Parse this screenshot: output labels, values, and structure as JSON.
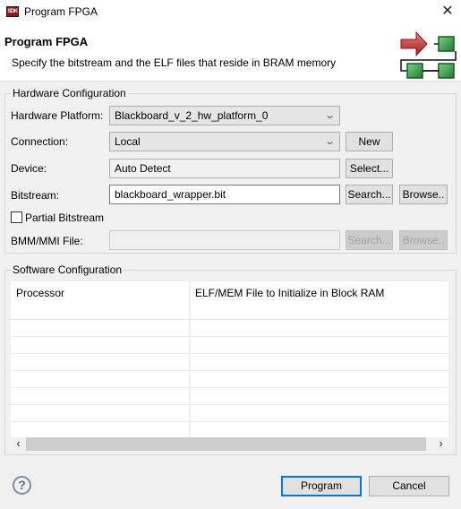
{
  "window": {
    "title": "Program FPGA",
    "icon": "sdk-icon",
    "icon_text": "SDK",
    "close_glyph": "✕"
  },
  "header": {
    "title": "Program FPGA",
    "description": "Specify the bitstream and the ELF files that reside in BRAM memory",
    "graphic": "fpga-program-graphic"
  },
  "hardware": {
    "legend": "Hardware Configuration",
    "platform_label": "Hardware Platform:",
    "platform_value": "Blackboard_v_2_hw_platform_0",
    "connection_label": "Connection:",
    "connection_value": "Local",
    "new_button": "New",
    "device_label": "Device:",
    "device_value": "Auto Detect",
    "select_button": "Select...",
    "bitstream_label": "Bitstream:",
    "bitstream_value": "blackboard_wrapper.bit",
    "search_button": "Search...",
    "browse_button": "Browse..",
    "partial_label": "Partial Bitstream",
    "partial_checked": false,
    "bmm_label": "BMM/MMI File:",
    "bmm_value": "",
    "bmm_search_button": "Search...",
    "bmm_browse_button": "Browse.."
  },
  "software": {
    "legend": "Software Configuration",
    "columns": [
      "Processor",
      "ELF/MEM File to Initialize in Block RAM"
    ],
    "rows": [],
    "scroll_left": "‹",
    "scroll_right": "›"
  },
  "footer": {
    "help_glyph": "?",
    "program_button": "Program",
    "cancel_button": "Cancel"
  },
  "colors": {
    "accent": "#0078d7",
    "arrow_red": "#c0262a",
    "block_green": "#2e9a3e"
  }
}
